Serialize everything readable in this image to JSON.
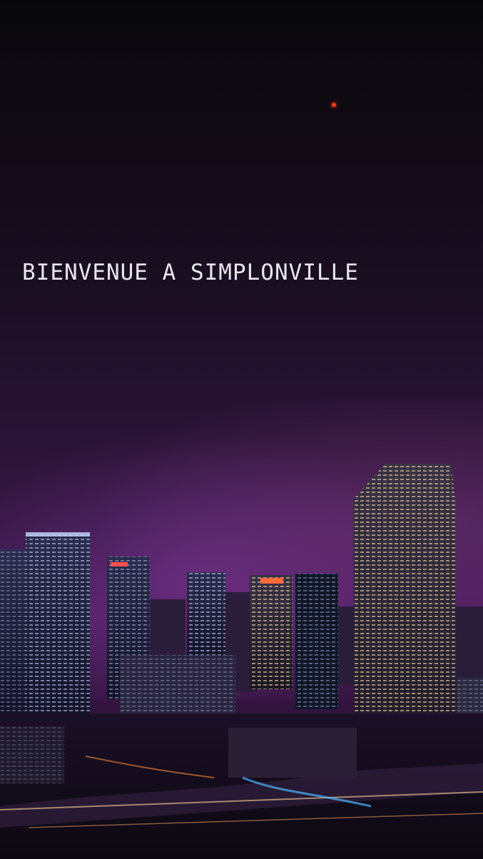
{
  "screen": {
    "title": "BIENVENUE A SIMPLONVILLE"
  },
  "colors": {
    "text": "#e9e6ee",
    "sky_top": "#07070a",
    "sky_glow": "#4a1d5d",
    "beacon": "#ff3a1a"
  },
  "background": {
    "icon": "city-skyline-night-image"
  }
}
